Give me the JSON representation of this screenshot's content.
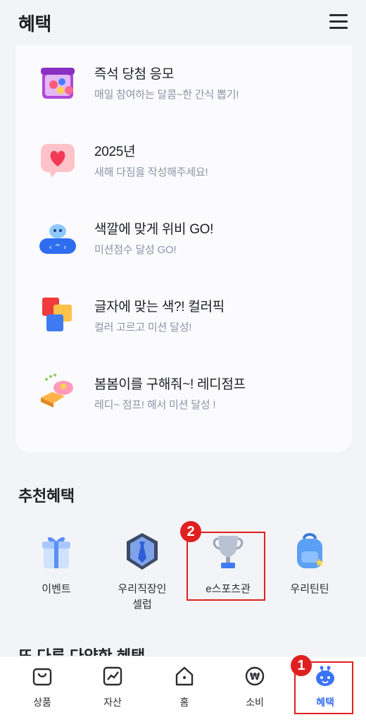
{
  "header": {
    "title": "혜택",
    "menu_icon": "hamburger-menu-icon"
  },
  "events": [
    {
      "title": "즉석 당첨 응모",
      "subtitle": "매일 참여하는 달콤~한 간식 뽑기!",
      "icon": "gift-box-icon"
    },
    {
      "title": "2025년",
      "subtitle": "새해 다짐을 작성해주세요!",
      "icon": "heart-speech-icon"
    },
    {
      "title": "색깔에 맞게 위비 GO!",
      "subtitle": "미션점수 달성 GO!",
      "icon": "wibee-game-icon"
    },
    {
      "title": "글자에 맞는 색?! 컬러픽",
      "subtitle": "컬러 고르고 미션 달성!",
      "icon": "color-blocks-icon"
    },
    {
      "title": "봄봄이를 구해줘~! 레디점프",
      "subtitle": "레디~ 점프! 해서 미션 달성 !",
      "icon": "jump-platform-icon"
    }
  ],
  "recommended": {
    "title": "추천혜택",
    "items": [
      {
        "label": "이벤트",
        "icon": "gift-icon"
      },
      {
        "label": "우리직장인\n셀럽",
        "label_line1": "우리직장인",
        "label_line2": "셀럽",
        "icon": "tie-badge-icon"
      },
      {
        "label": "e스포츠관",
        "icon": "trophy-icon"
      },
      {
        "label": "우리틴틴",
        "icon": "backpack-icon"
      }
    ]
  },
  "more_section_title": "또 다른 다양한 혜택",
  "tabs": [
    {
      "label": "상품",
      "icon": "bag-icon",
      "active": false
    },
    {
      "label": "자산",
      "icon": "chart-icon",
      "active": false
    },
    {
      "label": "홈",
      "icon": "home-icon",
      "active": false
    },
    {
      "label": "소비",
      "icon": "won-icon",
      "active": false
    },
    {
      "label": "혜택",
      "icon": "wibee-face-icon",
      "active": true
    }
  ],
  "annotations": [
    {
      "number": "1"
    },
    {
      "number": "2"
    }
  ],
  "colors": {
    "accent": "#3b73f5",
    "highlight": "#e02020",
    "subtitle": "#8b93a6",
    "background": "#f3f4f7"
  }
}
